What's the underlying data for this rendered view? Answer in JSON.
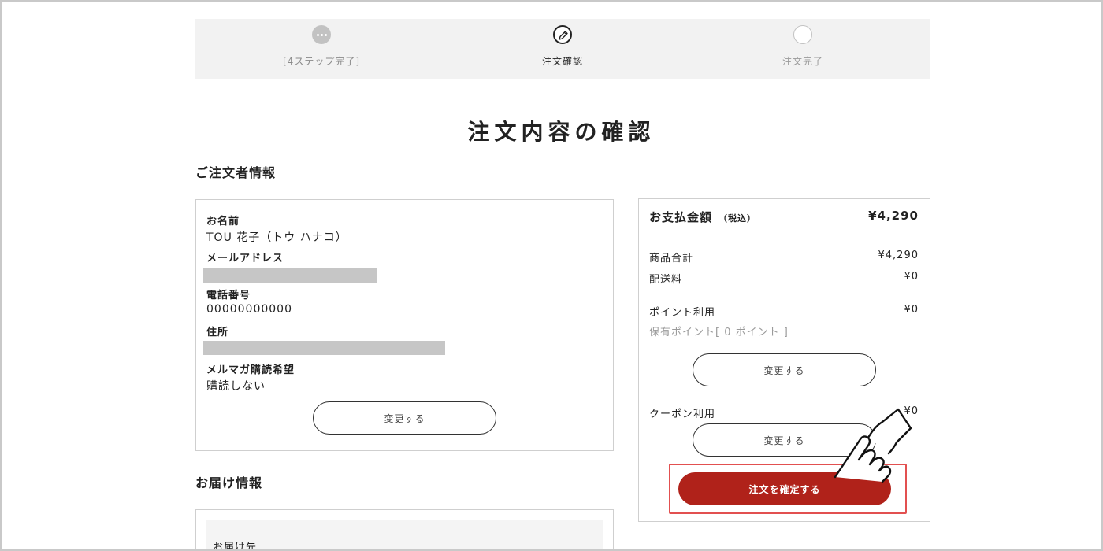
{
  "stepper": {
    "steps": [
      {
        "label": "[4ステップ完了]",
        "state": "done"
      },
      {
        "label": "注文確認",
        "state": "current"
      },
      {
        "label": "注文完了",
        "state": "todo"
      }
    ]
  },
  "page_title": "注文内容の確認",
  "orderer": {
    "section_title": "ご注文者情報",
    "name_label": "お名前",
    "name_value": "TOU 花子（トウ ハナコ）",
    "email_label": "メールアドレス",
    "phone_label": "電話番号",
    "phone_value": "00000000000",
    "address_label": "住所",
    "newsletter_label": "メルマガ購読希望",
    "newsletter_value": "購読しない",
    "change_button": "変更する"
  },
  "delivery": {
    "section_title": "お届け情報",
    "destination_label": "お届け先"
  },
  "payment": {
    "heading": "お支払金額",
    "tax_note": "（税込）",
    "total": "¥4,290",
    "subtotal_label": "商品合計",
    "subtotal_value": "¥4,290",
    "shipping_label": "配送料",
    "shipping_value": "¥0",
    "points_label": "ポイント利用",
    "points_value": "¥0",
    "points_held": "保有ポイント[ 0 ポイント ]",
    "points_change_button": "変更する",
    "coupon_label": "クーポン利用",
    "coupon_value": "¥0",
    "coupon_change_button": "変更する",
    "confirm_button": "注文を確定する"
  },
  "colors": {
    "confirm_button": "#b0221a",
    "highlight_border": "#e25050",
    "stepper_bg": "#f2f2f2"
  },
  "icons": {
    "step_done": "ellipsis-icon",
    "step_current": "pencil-icon",
    "pointer": "pointing-hand-icon"
  }
}
